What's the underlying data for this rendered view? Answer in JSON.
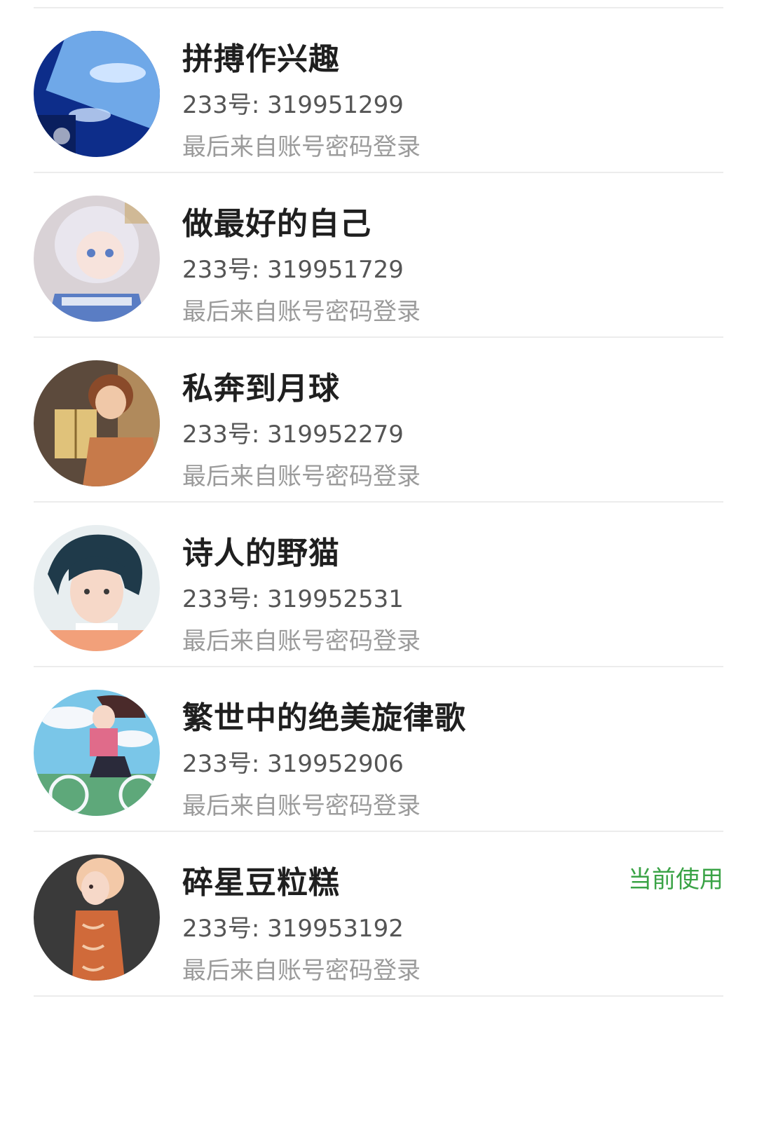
{
  "accounts": [
    {
      "nickname": "拼搏作兴趣",
      "id_prefix": "233号: ",
      "id_number": "319951299",
      "login_source": "最后来自账号密码登录",
      "avatar_icon": "avatar-blue-sky-window",
      "avatar_colors": {
        "bg": "#0d2d8a",
        "accent": "#6fa8e8",
        "light": "#cfe4ff"
      },
      "current": false
    },
    {
      "nickname": "做最好的自己",
      "id_prefix": "233号: ",
      "id_number": "319951729",
      "login_source": "最后来自账号密码登录",
      "avatar_icon": "avatar-silver-hair-anime-girl",
      "avatar_colors": {
        "bg": "#d9d2d6",
        "accent": "#5a7dc4",
        "light": "#f2f0f4"
      },
      "current": false
    },
    {
      "nickname": "私奔到月球",
      "id_prefix": "233号: ",
      "id_number": "319952279",
      "login_source": "最后来自账号密码登录",
      "avatar_icon": "avatar-girl-reading-book",
      "avatar_colors": {
        "bg": "#5c4a3c",
        "accent": "#c77a4a",
        "light": "#e0c27a"
      },
      "current": false
    },
    {
      "nickname": "诗人的野猫",
      "id_prefix": "233号: ",
      "id_number": "319952531",
      "login_source": "最后来自账号密码登录",
      "avatar_icon": "avatar-dark-hair-boy",
      "avatar_colors": {
        "bg": "#e8eef0",
        "accent": "#1f3a4a",
        "light": "#f6d8c8"
      },
      "current": false
    },
    {
      "nickname": "繁世中的绝美旋律歌",
      "id_prefix": "233号: ",
      "id_number": "319952906",
      "login_source": "最后来自账号密码登录",
      "avatar_icon": "avatar-girl-on-bicycle",
      "avatar_colors": {
        "bg": "#7ac6e8",
        "accent": "#e06b8a",
        "light": "#f4f7fb"
      },
      "current": false
    },
    {
      "nickname": "碎星豆粒糕",
      "id_prefix": "233号: ",
      "id_number": "319953192",
      "login_source": "最后来自账号密码登录",
      "avatar_icon": "avatar-orange-shirt-girl",
      "avatar_colors": {
        "bg": "#3a3a3a",
        "accent": "#d06a3a",
        "light": "#f3c9a8"
      },
      "current": true,
      "current_label": "当前使用"
    }
  ],
  "colors": {
    "current_label": "#3aa346",
    "divider": "#ececec"
  }
}
